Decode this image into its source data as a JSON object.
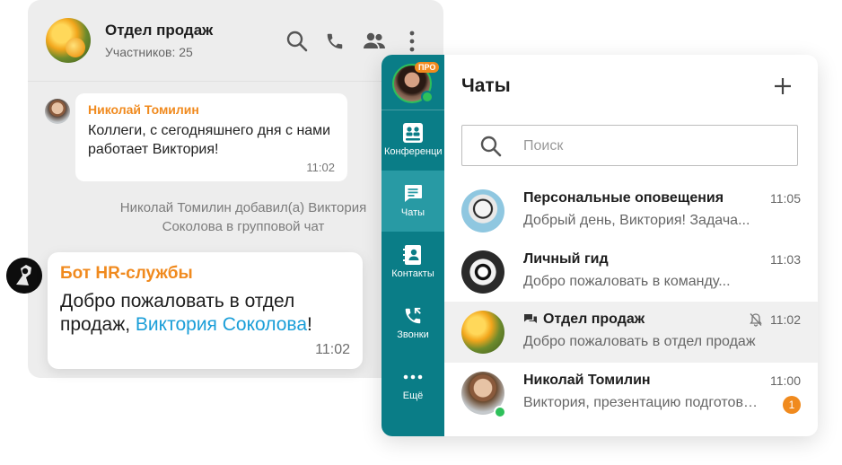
{
  "group": {
    "title": "Отдел продаж",
    "members": "Участников: 25"
  },
  "messages": [
    {
      "author": "Николай Томилин",
      "text": "Коллеги, с сегодняшнего дня с нами работает Виктория!",
      "time": "11:02"
    }
  ],
  "system_note": "Николай Томилин добавил(а) Виктория Соколова в групповой чат",
  "bot_message": {
    "author": "Бот HR-службы",
    "text_before": "Добро пожаловать в отдел продаж, ",
    "link": "Виктория Соколова",
    "text_after": "!",
    "time": "11:02"
  },
  "sidebar": {
    "pro_badge": "ПРО",
    "items": [
      {
        "label": "Конференции",
        "icon": "conference-icon"
      },
      {
        "label": "Чаты",
        "icon": "chat-icon"
      },
      {
        "label": "Контакты",
        "icon": "contacts-icon"
      },
      {
        "label": "Звонки",
        "icon": "calls-icon"
      },
      {
        "label": "Ещё",
        "icon": "more-icon"
      }
    ]
  },
  "chats": {
    "title": "Чаты",
    "search_placeholder": "Поиск",
    "list": [
      {
        "name": "Персональные оповещения",
        "preview": "Добрый день, Виктория! Задача...",
        "time": "11:05"
      },
      {
        "name": "Личный гид",
        "preview": "Добро пожаловать в команду...",
        "time": "11:03"
      },
      {
        "name": "Отдел продаж",
        "preview": "Добро пожаловать в отдел продаж",
        "time": "11:02",
        "muted": true,
        "group": true
      },
      {
        "name": "Николай Томилин",
        "preview": "Виктория, презентацию подготовила",
        "time": "11:00",
        "unread": "1"
      }
    ]
  },
  "colors": {
    "accent_orange": "#f08a1e",
    "sidebar_teal": "#0a7d87",
    "sidebar_active": "#289aa4",
    "link_blue": "#1a9ed8",
    "online_green": "#2ec05a"
  }
}
